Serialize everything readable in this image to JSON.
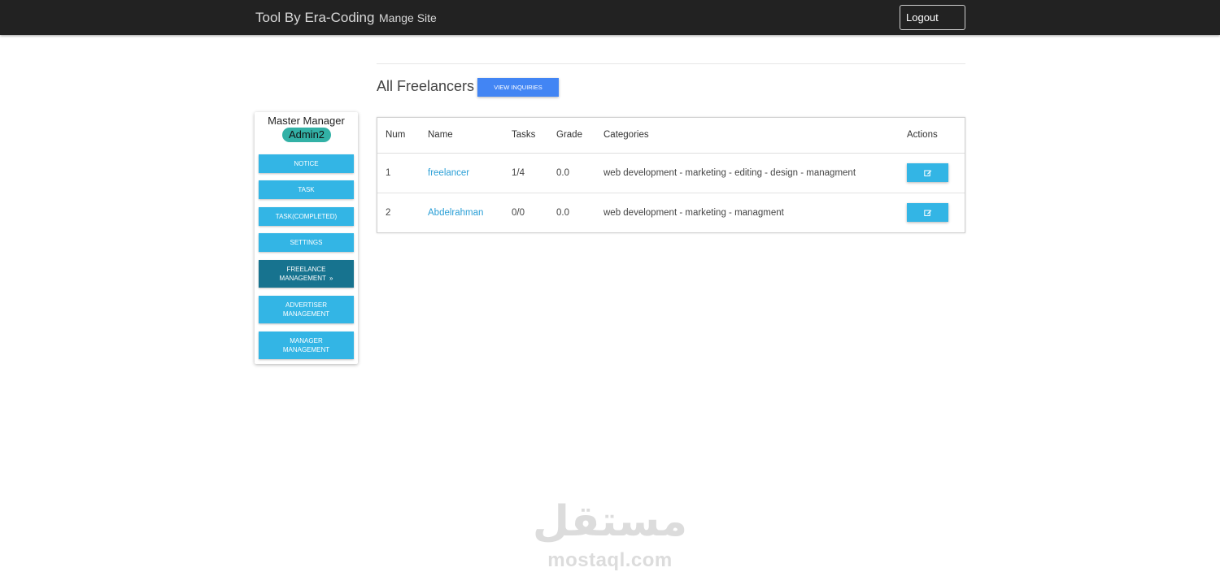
{
  "navbar": {
    "brand": "Tool By Era-Coding",
    "link": "Mange Site",
    "logout_label": "Logout"
  },
  "sidebar": {
    "title": "Master Manager",
    "badge": "Admin2",
    "items": [
      {
        "label": "NOTICE"
      },
      {
        "label": "TASK"
      },
      {
        "label": "TASK(COMPLETED)"
      },
      {
        "label": "SETTINGS"
      },
      {
        "label": "FREELANCE MANAGEMENT"
      },
      {
        "label": "ADVERTISER MANAGEMENT"
      },
      {
        "label": "MANAGER MANAGEMENT"
      }
    ],
    "active_arrow": "»"
  },
  "main": {
    "title": "All Freelancers",
    "view_button": "VIEW INQUIRIES",
    "table": {
      "headers": [
        "Num",
        "Name",
        "Tasks",
        "Grade",
        "Categories",
        "Actions"
      ],
      "rows": [
        {
          "num": "1",
          "name": "freelancer",
          "tasks": "1/4",
          "grade": "0.0",
          "categories": "web development - marketing - editing - design - managment"
        },
        {
          "num": "2",
          "name": "Abdelrahman",
          "tasks": "0/0",
          "grade": "0.0",
          "categories": "web development - marketing - managment"
        }
      ]
    }
  },
  "watermark": {
    "arabic": "مستقل",
    "latin": "mostaql.com"
  },
  "colors": {
    "navbar": "#222222",
    "button": "#33b5e5",
    "button_active": "#17738f",
    "badge": "#32b1a6",
    "primary": "#4285f4",
    "link": "#2a9fd6"
  },
  "icons": {
    "edit": "edit-icon"
  }
}
